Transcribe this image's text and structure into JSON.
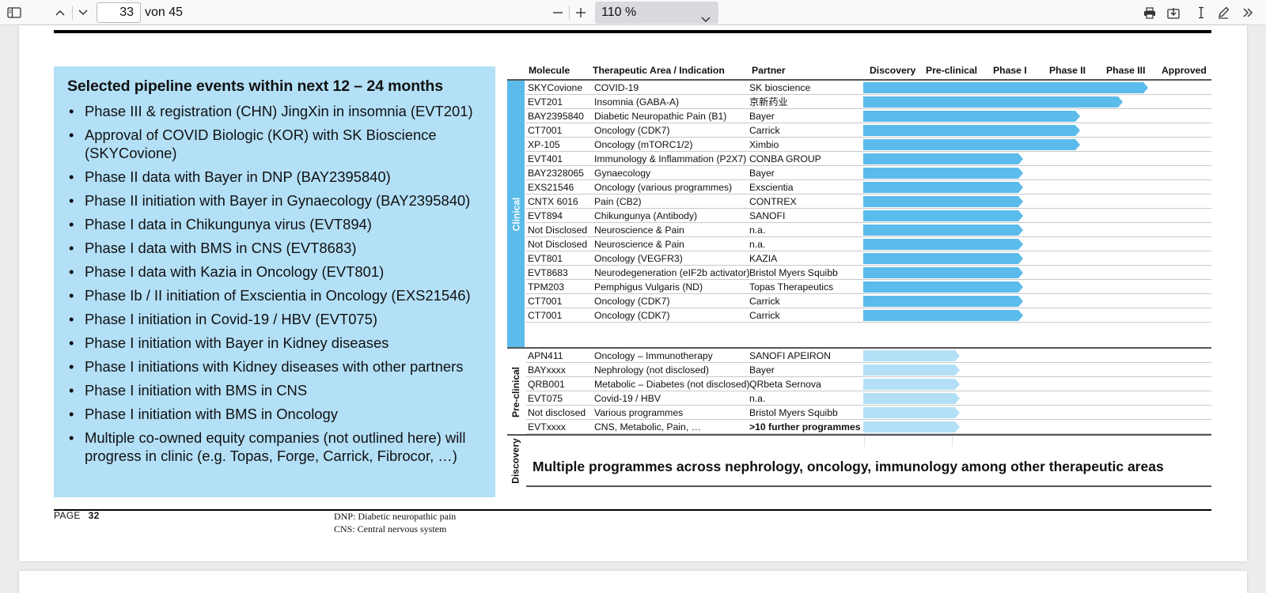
{
  "toolbar": {
    "page_current": "33",
    "page_total": "von 45",
    "zoom": "110 %",
    "icons": [
      "sidebar-toggle-icon",
      "chevron-up-icon",
      "chevron-down-icon",
      "zoom-out-icon",
      "zoom-in-icon",
      "print-icon",
      "save-icon",
      "text-cursor-icon",
      "draw-icon",
      "more-tools-icon"
    ]
  },
  "events": {
    "title": "Selected pipeline events within next 12 – 24 months",
    "items": [
      "Phase III & registration (CHN) JingXin in insomnia (EVT201)",
      "Approval of COVID Biologic (KOR) with SK Bioscience (SKYCovione)",
      "Phase II data with Bayer in DNP (BAY2395840)",
      "Phase II initiation with Bayer in Gynaecology (BAY2395840)",
      "Phase I data in Chikungunya virus (EVT894)",
      "Phase I data with BMS in CNS (EVT8683)",
      "Phase I data with Kazia in Oncology (EVT801)",
      "Phase Ib / II initiation of Exscientia in Oncology (EXS21546)",
      "Phase I initiation in Covid-19 / HBV (EVT075)",
      "Phase I initiation with Bayer in Kidney diseases",
      "Phase I initiations with Kidney diseases with other partners",
      "Phase I initiation with BMS in CNS",
      "Phase I initiation with BMS in Oncology",
      "Multiple co-owned equity companies (not outlined here) will progress in clinic (e.g. Topas, Forge, Carrick, Fibrocor, …)"
    ]
  },
  "table": {
    "headers": {
      "molecule": "Molecule",
      "area": "Therapeutic Area / Indication",
      "partner": "Partner",
      "discovery": "Discovery",
      "preclinical": "Pre-clinical",
      "phase1": "Phase I",
      "phase2": "Phase II",
      "phase3": "Phase III",
      "approved": "Approved"
    },
    "sections": {
      "clinical": "Clinical",
      "preclinical": "Pre-clinical",
      "discovery": "Discovery"
    },
    "clinical_rows": [
      {
        "molecule": "SKYCovione",
        "area": "COVID-19",
        "partner": "SK bioscience",
        "stage": 5.0
      },
      {
        "molecule": "EVT201",
        "area": "Insomnia (GABA-A)",
        "partner": "京新药业",
        "stage": 4.55
      },
      {
        "molecule": "BAY2395840",
        "area": "Diabetic Neuropathic Pain (B1)",
        "partner": "Bayer",
        "stage": 3.8
      },
      {
        "molecule": "CT7001",
        "area": "Oncology (CDK7)",
        "partner": "Carrick",
        "stage": 3.8
      },
      {
        "molecule": "XP-105",
        "area": "Oncology (mTORC1/2)",
        "partner": "Ximbio",
        "stage": 3.8
      },
      {
        "molecule": "EVT401",
        "area": "Immunology & Inflammation (P2X7)",
        "partner": "CONBA GROUP",
        "stage": 2.8
      },
      {
        "molecule": "BAY2328065",
        "area": "Gynaecology",
        "partner": "Bayer",
        "stage": 2.8
      },
      {
        "molecule": "EXS21546",
        "area": "Oncology (various programmes)",
        "partner": "Exscientia",
        "stage": 2.8
      },
      {
        "molecule": "CNTX 6016",
        "area": "Pain (CB2)",
        "partner": "CONTREX",
        "stage": 2.8
      },
      {
        "molecule": "EVT894",
        "area": "Chikungunya (Antibody)",
        "partner": "SANOFI",
        "stage": 2.8
      },
      {
        "molecule": "Not Disclosed",
        "area": "Neuroscience & Pain",
        "partner": "n.a.",
        "stage": 2.8
      },
      {
        "molecule": "Not Disclosed",
        "area": "Neuroscience & Pain",
        "partner": "n.a.",
        "stage": 2.8
      },
      {
        "molecule": "EVT801",
        "area": "Oncology (VEGFR3)",
        "partner": "KAZIA",
        "stage": 2.8
      },
      {
        "molecule": "EVT8683",
        "area": "Neurodegeneration (eIF2b activator)",
        "partner": "Bristol Myers Squibb",
        "stage": 2.8
      },
      {
        "molecule": "TPM203",
        "area": "Pemphigus Vulgaris (ND)",
        "partner": "Topas Therapeutics",
        "stage": 2.8
      },
      {
        "molecule": "CT7001",
        "area": "Oncology (CDK7)",
        "partner": "Carrick",
        "stage": 2.8
      },
      {
        "molecule": "CT7001",
        "area": "Oncology (CDK7)",
        "partner": "Carrick",
        "stage": 2.8
      }
    ],
    "preclinical_rows": [
      {
        "molecule": "APN411",
        "area": "Oncology – Immunotherapy",
        "partner": "SANOFI APEIRON",
        "stage": 1.7
      },
      {
        "molecule": "BAYxxxx",
        "area": "Nephrology (not disclosed)",
        "partner": "Bayer",
        "stage": 1.7
      },
      {
        "molecule": "QRB001",
        "area": "Metabolic – Diabetes (not disclosed)",
        "partner": "QRbeta Sernova",
        "stage": 1.7
      },
      {
        "molecule": "EVT075",
        "area": "Covid-19 / HBV",
        "partner": "n.a.",
        "stage": 1.7
      },
      {
        "molecule": "Not disclosed",
        "area": "Various programmes",
        "partner": "Bristol Myers Squibb",
        "stage": 1.7
      },
      {
        "molecule": "EVTxxxx",
        "area": "CNS, Metabolic, Pain, …",
        "partner": ">10 further programmes",
        "stage": 1.7
      }
    ],
    "discovery_text": "Multiple programmes across nephrology, oncology, immunology among other therapeutic areas"
  },
  "footer": {
    "page_word": "PAGE",
    "page_number": "32",
    "notes": [
      "DNP: Diabetic neuropathic pain",
      "CNS: Central nervous system"
    ]
  },
  "colors": {
    "clinical_bar": "#5bbbea",
    "preclinical_bar": "#b3e0f7",
    "events_box": "#b3e0f7"
  }
}
